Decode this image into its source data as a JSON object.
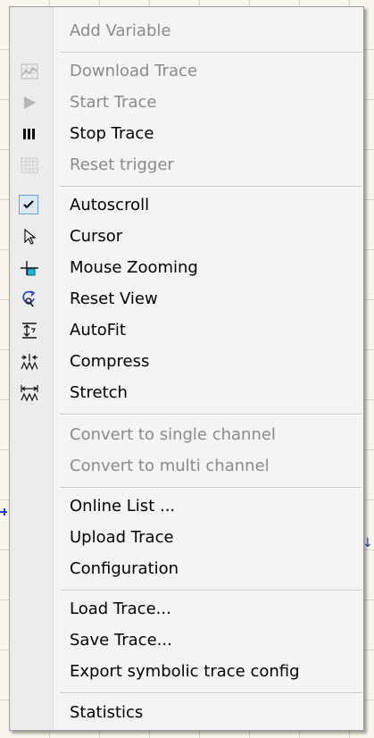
{
  "menu": {
    "items": [
      {
        "label": "Add Variable",
        "icon": "none",
        "enabled": false
      },
      {
        "label": "Download Trace",
        "icon": "download-trace-icon",
        "enabled": false
      },
      {
        "label": "Start Trace",
        "icon": "play-icon",
        "enabled": false
      },
      {
        "label": "Stop Trace",
        "icon": "stop-trace-icon",
        "enabled": true
      },
      {
        "label": "Reset trigger",
        "icon": "reset-trigger-icon",
        "enabled": false
      },
      {
        "label": "Autoscroll",
        "icon": "checkmark-icon",
        "enabled": true,
        "checked": true
      },
      {
        "label": "Cursor",
        "icon": "cursor-arrow-icon",
        "enabled": true
      },
      {
        "label": "Mouse Zooming",
        "icon": "mouse-zoom-icon",
        "enabled": true
      },
      {
        "label": "Reset View",
        "icon": "reset-view-icon",
        "enabled": true
      },
      {
        "label": "AutoFit",
        "icon": "autofit-icon",
        "enabled": true
      },
      {
        "label": "Compress",
        "icon": "compress-icon",
        "enabled": true
      },
      {
        "label": "Stretch",
        "icon": "stretch-icon",
        "enabled": true
      },
      {
        "label": "Convert to single channel",
        "icon": "none",
        "enabled": false
      },
      {
        "label": "Convert to multi channel",
        "icon": "none",
        "enabled": false
      },
      {
        "label": "Online List ...",
        "icon": "none",
        "enabled": true
      },
      {
        "label": "Upload Trace",
        "icon": "none",
        "enabled": true
      },
      {
        "label": "Configuration",
        "icon": "none",
        "enabled": true
      },
      {
        "label": "Load Trace...",
        "icon": "none",
        "enabled": true
      },
      {
        "label": "Save Trace...",
        "icon": "none",
        "enabled": true
      },
      {
        "label": "Export symbolic trace config",
        "icon": "none",
        "enabled": true
      },
      {
        "label": "Statistics",
        "icon": "none",
        "enabled": true
      }
    ]
  },
  "colors": {
    "trace": "#1a3fd6",
    "accent_check": "#6f9fd8",
    "disabled_text": "#8a8a8a"
  }
}
